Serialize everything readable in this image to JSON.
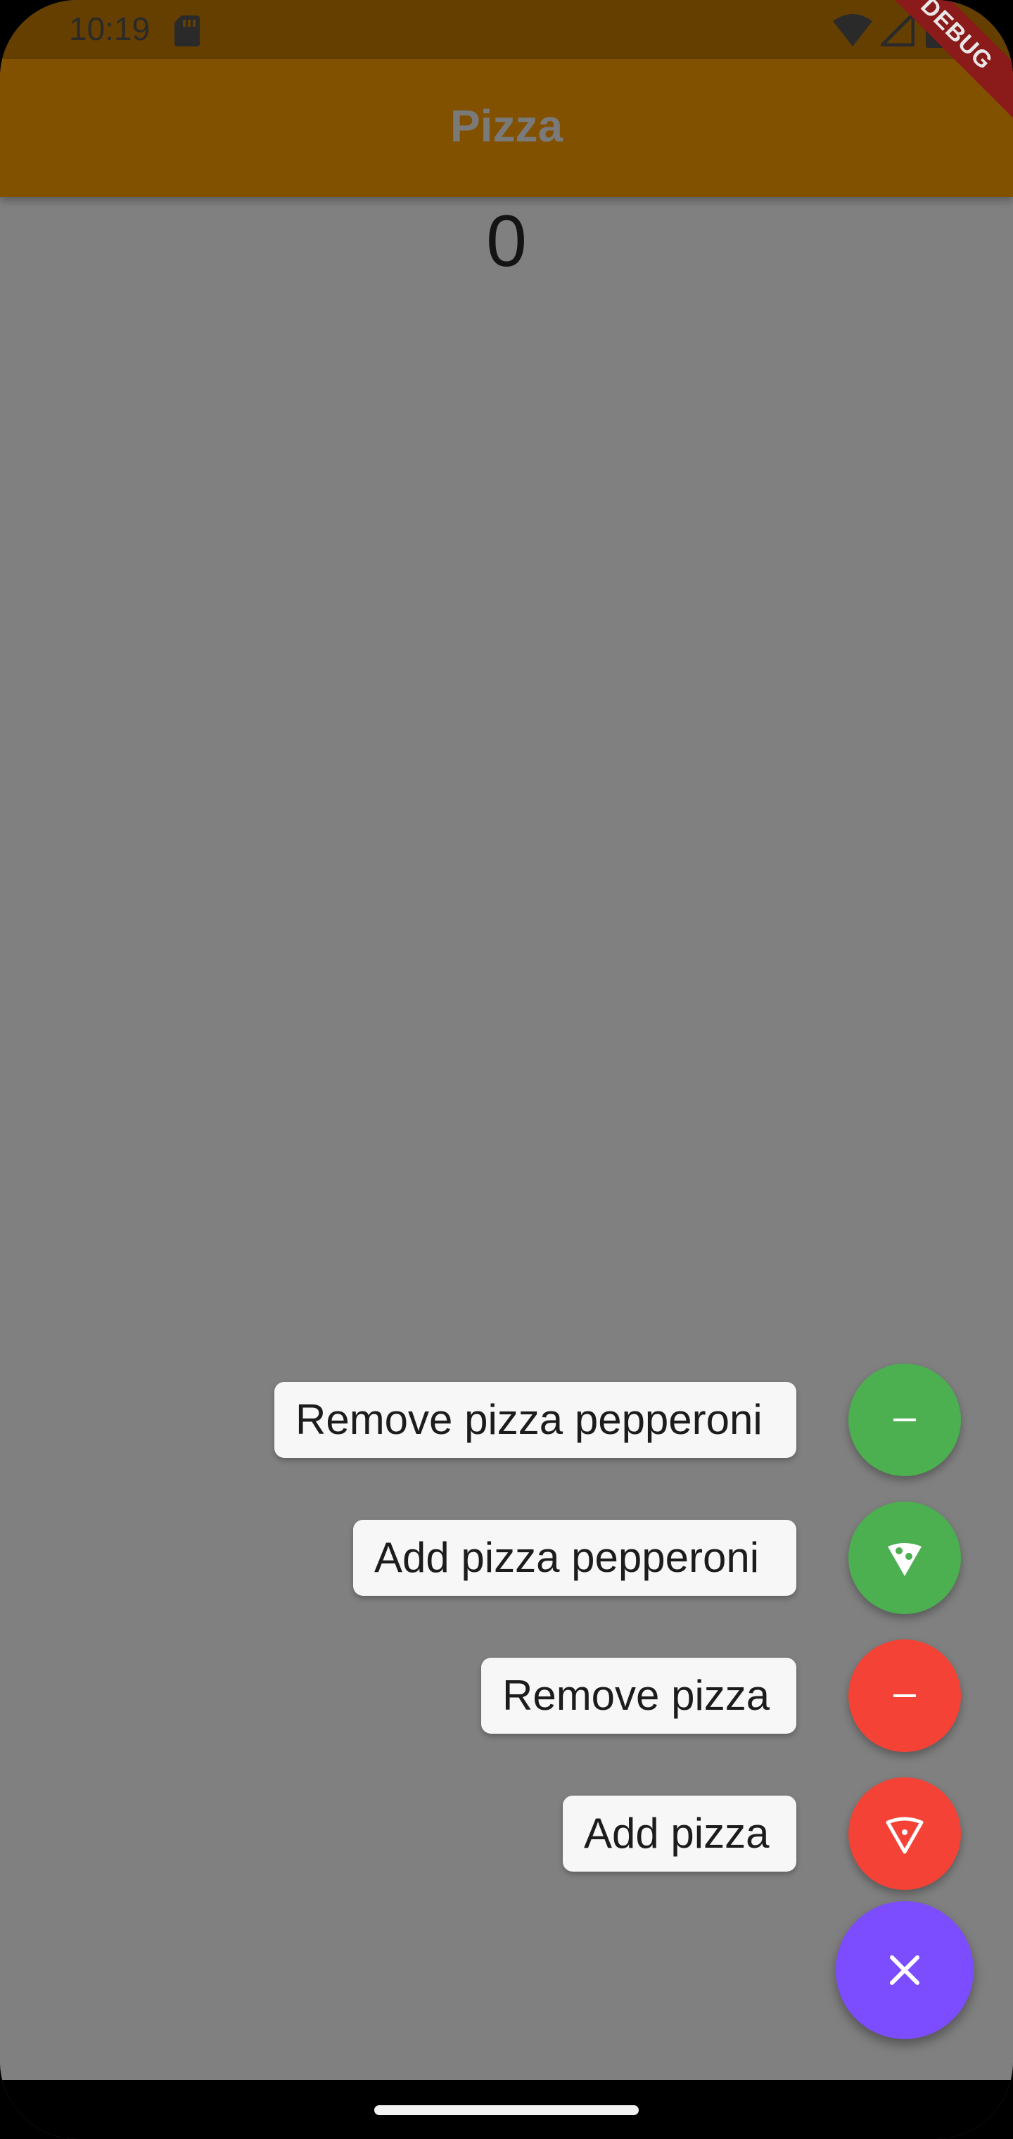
{
  "status_bar": {
    "time": "10:19",
    "icons": [
      "sd-card-icon",
      "wifi-icon",
      "signal-icon",
      "battery-icon"
    ]
  },
  "app_bar": {
    "title": "Pizza",
    "debug_banner": "DEBUG"
  },
  "main": {
    "counter_value": "0"
  },
  "speed_dial": {
    "actions": [
      {
        "label": "Remove pizza pepperoni",
        "icon": "minus-icon",
        "color": "#4caf50"
      },
      {
        "label": "Add pizza pepperoni",
        "icon": "pizza-slice-icon",
        "color": "#4caf50"
      },
      {
        "label": "Remove pizza",
        "icon": "minus-icon",
        "color": "#f44336"
      },
      {
        "label": "Add pizza",
        "icon": "pizza-slice-icon",
        "color": "#f44336"
      }
    ],
    "main_button_icon": "close-icon",
    "main_button_color": "#7c4dff"
  },
  "colors": {
    "status_bar": "#653f00",
    "app_bar": "#825100",
    "scrim_background": "#808080"
  }
}
